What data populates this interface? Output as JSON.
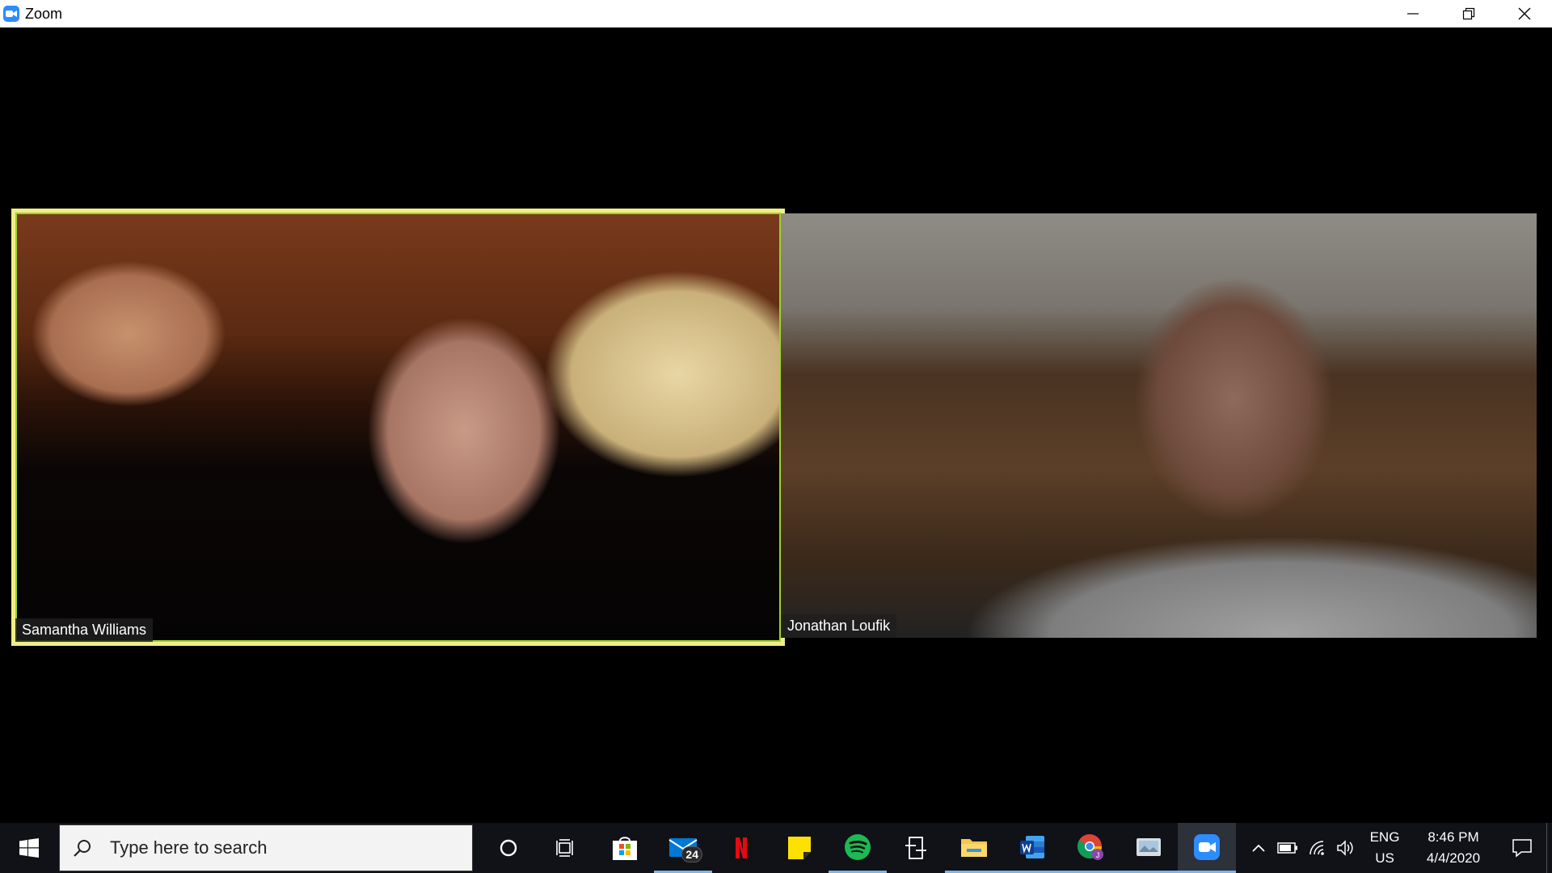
{
  "window": {
    "title": "Zoom",
    "controls": [
      "minimize",
      "restore",
      "close"
    ]
  },
  "participants": [
    {
      "name": "Samantha Williams",
      "active_speaker": true
    },
    {
      "name": "Jonathan Loufik",
      "active_speaker": false
    }
  ],
  "taskbar": {
    "search_placeholder": "Type here to search",
    "apps": [
      {
        "name": "cortana-icon"
      },
      {
        "name": "task-view-icon"
      },
      {
        "name": "microsoft-store-icon"
      },
      {
        "name": "mail-icon",
        "badge": "24"
      },
      {
        "name": "netflix-icon"
      },
      {
        "name": "sticky-notes-icon"
      },
      {
        "name": "spotify-icon"
      },
      {
        "name": "connect-icon"
      },
      {
        "name": "file-explorer-icon"
      },
      {
        "name": "word-icon"
      },
      {
        "name": "chrome-icon"
      },
      {
        "name": "photos-app-icon"
      },
      {
        "name": "zoom-icon"
      }
    ],
    "language": {
      "line1": "ENG",
      "line2": "US"
    },
    "clock": {
      "time": "8:46 PM",
      "date": "4/4/2020"
    }
  },
  "colors": {
    "active_speaker_border": "#f0ee86",
    "zoom_blue": "#2D8CFF",
    "taskbar_bg": "#101218"
  }
}
